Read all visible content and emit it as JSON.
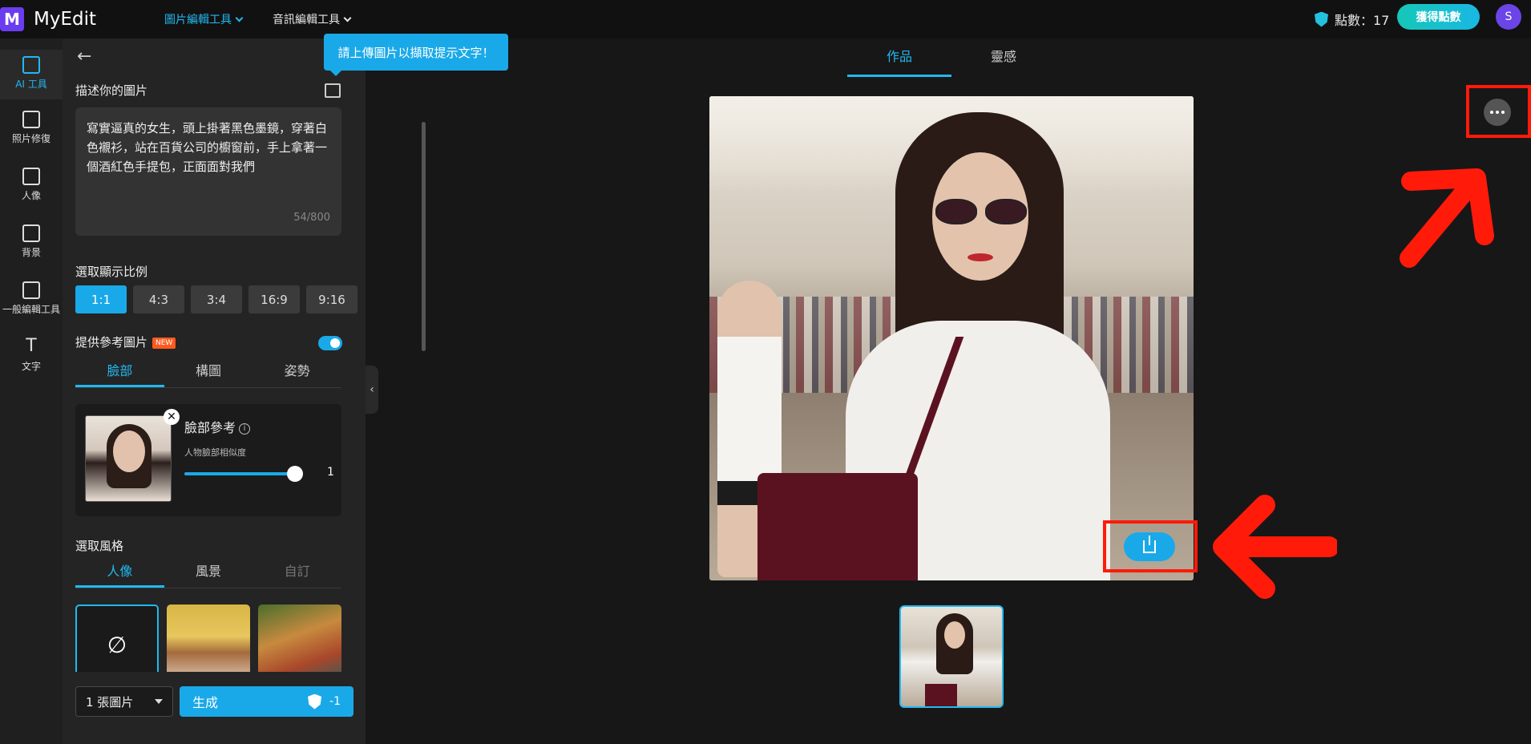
{
  "app": {
    "name": "MyEdit",
    "logo_letter": "M"
  },
  "topnav": {
    "items": [
      {
        "label": "圖片編輯工具",
        "active": true
      },
      {
        "label": "音訊編輯工具",
        "active": false
      }
    ]
  },
  "header": {
    "points_label": "點數：17",
    "get_points_label": "獲得點數",
    "avatar_initial": "S"
  },
  "leftnav": {
    "items": [
      {
        "label": "AI 工具",
        "icon": "magic-wand-icon",
        "active": true
      },
      {
        "label": "照片修復",
        "icon": "photo-repair-icon"
      },
      {
        "label": "人像",
        "icon": "portrait-icon"
      },
      {
        "label": "背景",
        "icon": "background-icon"
      },
      {
        "label": "一般編輯工具",
        "icon": "general-tools-icon"
      },
      {
        "label": "文字",
        "icon": "text-icon"
      }
    ]
  },
  "panel": {
    "tooltip": "請上傳圖片以擷取提示文字！",
    "describe_label": "描述你的圖片",
    "prompt": "寫實逼真的女生，頭上掛著黑色墨鏡，穿著白色襯衫，站在百貨公司的櫥窗前，手上拿著一個酒紅色手提包，正面面對我們",
    "counter": "54/800",
    "ratio_label": "選取顯示比例",
    "ratios": [
      "1:1",
      "4:3",
      "3:4",
      "16:9",
      "9:16"
    ],
    "ratio_selected": "1:1",
    "reference_label": "提供參考圖片",
    "new_badge": "NEW",
    "reference_enabled": true,
    "reference_tabs": [
      "臉部",
      "構圖",
      "姿勢"
    ],
    "face_ref": {
      "title": "臉部參考",
      "info": "i",
      "similarity_label": "人物臉部相似度",
      "similarity_value": "1",
      "similarity_level": 1.0
    },
    "style_label": "選取風格",
    "style_tabs": [
      "人像",
      "風景",
      "自訂"
    ],
    "style_none_symbol": "∅",
    "count_select": "1 張圖片",
    "generate_label": "生成",
    "generate_cost": "-1"
  },
  "main": {
    "tabs": [
      "作品",
      "靈感"
    ],
    "active_tab": "作品"
  },
  "colors": {
    "accent": "#22b8f0",
    "annotation": "#ff1a0a",
    "brand": "#6a3df0"
  }
}
